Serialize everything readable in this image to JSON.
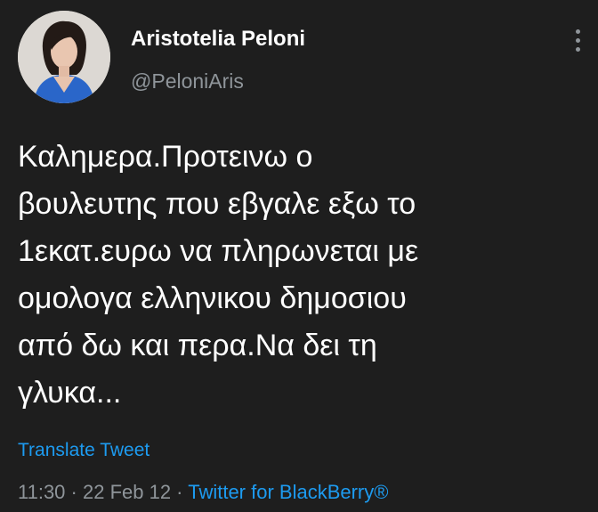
{
  "tweet": {
    "author": {
      "display_name": "Aristotelia Peloni",
      "handle": "@PeloniAris",
      "avatar_icon": "profile-photo"
    },
    "text": "Καλημερα.Προτεινω ο\nβουλευτης που εβγαλε εξω το\n1εκατ.ευρω να πληρωνεται με\nομολογα ελληνικου δημοσιου\nαπό δω και περα.Να δει τη\nγλυκα...",
    "translate_label": "Translate Tweet",
    "time": "11:30",
    "separator": " · ",
    "date": "22 Feb 12",
    "source": "Twitter for BlackBerry®",
    "more_icon": "vertical-ellipsis-icon"
  },
  "colors": {
    "background": "#1e1e1e",
    "primary_text": "#ffffff",
    "secondary_text": "#8f959a",
    "link": "#1d9bf0"
  }
}
